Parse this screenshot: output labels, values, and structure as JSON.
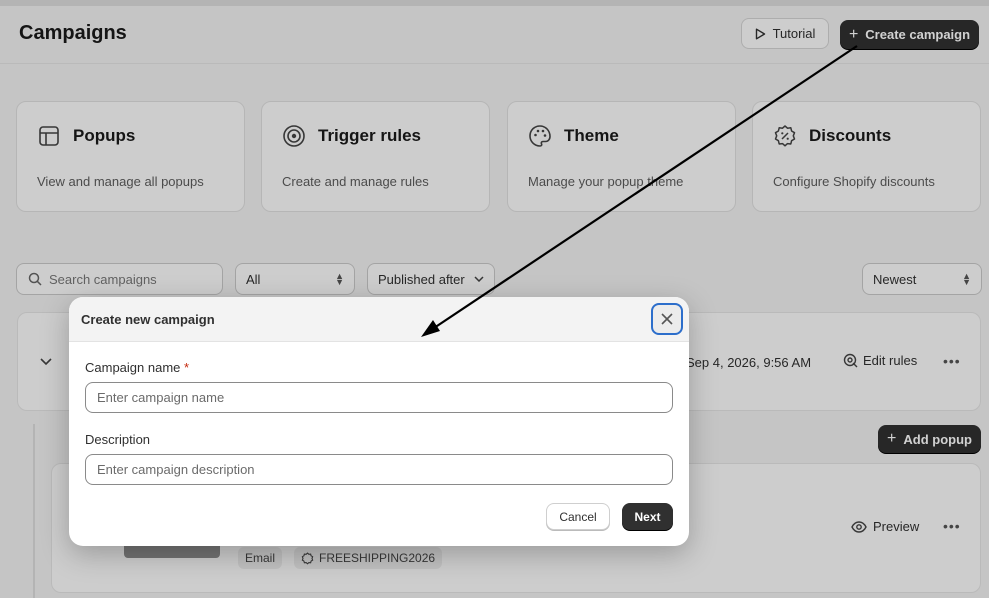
{
  "header": {
    "title": "Campaigns",
    "tutorial_label": "Tutorial",
    "create_label": "Create campaign"
  },
  "cards": [
    {
      "title": "Popups",
      "desc": "View and manage all popups",
      "icon": "layout-icon"
    },
    {
      "title": "Trigger rules",
      "desc": "Create and manage rules",
      "icon": "target-icon"
    },
    {
      "title": "Theme",
      "desc": "Manage your popup theme",
      "icon": "palette-icon"
    },
    {
      "title": "Discounts",
      "desc": "Configure Shopify discounts",
      "icon": "discount-icon"
    }
  ],
  "filters": {
    "search_placeholder": "Search campaigns",
    "status_value": "All",
    "date_value": "Published after",
    "sort_value": "Newest"
  },
  "campaign_row": {
    "date": "Sep 4, 2026, 9:56 AM",
    "edit_rules_label": "Edit rules"
  },
  "add_popup_label": "Add popup",
  "popup_row": {
    "tag_email": "Email",
    "tag_code": "FREESHIPPING2026",
    "preview_label": "Preview"
  },
  "modal": {
    "title": "Create new campaign",
    "name_label": "Campaign name",
    "required_mark": "*",
    "name_placeholder": "Enter campaign name",
    "desc_label": "Description",
    "desc_placeholder": "Enter campaign description",
    "cancel_label": "Cancel",
    "next_label": "Next"
  },
  "colors": {
    "primary_button": "#303030",
    "focus_ring": "#2c6ecb",
    "required": "#c5280c"
  }
}
